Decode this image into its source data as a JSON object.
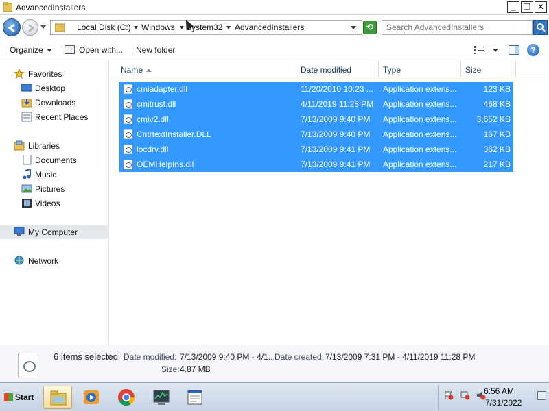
{
  "window": {
    "title": "AdvancedInstallers",
    "controls": {
      "minimize": "_",
      "maximize": "❐",
      "close": "✕"
    }
  },
  "address": {
    "crumbs": [
      "Local Disk (C:)",
      "Windows",
      "System32",
      "AdvancedInstallers"
    ],
    "search_placeholder": "Search AdvancedInstallers"
  },
  "toolbar": {
    "organize": "Organize",
    "open_with": "Open with...",
    "new_folder": "New folder"
  },
  "sidebar": {
    "favorites": {
      "label": "Favorites",
      "icon": "star-icon",
      "items": [
        "Desktop",
        "Downloads",
        "Recent Places"
      ]
    },
    "libraries": {
      "label": "Libraries",
      "icon": "library-icon",
      "items": [
        "Documents",
        "Music",
        "Pictures",
        "Videos"
      ]
    },
    "computer": {
      "label": "My Computer",
      "icon": "computer-icon"
    },
    "network": {
      "label": "Network",
      "icon": "network-icon"
    }
  },
  "columns": {
    "name": "Name",
    "date_modified": "Date modified",
    "type": "Type",
    "size": "Size"
  },
  "files": [
    {
      "name": "cmiadapter.dll",
      "date": "11/20/2010 10:23 ...",
      "type": "Application extens...",
      "size": "123 KB"
    },
    {
      "name": "cmitrust.dll",
      "date": "4/11/2019 11:28 PM",
      "type": "Application extens...",
      "size": "468 KB"
    },
    {
      "name": "cmiv2.dll",
      "date": "7/13/2009 9:40 PM",
      "type": "Application extens...",
      "size": "3,652 KB"
    },
    {
      "name": "CntrtextInstaller.DLL",
      "date": "7/13/2009 9:40 PM",
      "type": "Application extens...",
      "size": "167 KB"
    },
    {
      "name": "locdrv.dll",
      "date": "7/13/2009 9:41 PM",
      "type": "Application extens...",
      "size": "362 KB"
    },
    {
      "name": "OEMHelpIns.dll",
      "date": "7/13/2009 9:41 PM",
      "type": "Application extens...",
      "size": "217 KB"
    }
  ],
  "details": {
    "count": "6 items selected",
    "date_modified_label": "Date modified:",
    "date_modified_value": "7/13/2009 9:40 PM - 4/1...",
    "date_created_label": "Date created:",
    "date_created_value": "7/13/2009 7:31 PM - 4/11/2019 11:28 PM",
    "size_label": "Size:",
    "size_value": "4.87 MB"
  },
  "taskbar": {
    "start": "Start",
    "apps": [
      "explorer-icon",
      "media-player-icon",
      "chrome-icon",
      "task-manager-icon",
      "notepad-icon"
    ],
    "time": "6:56 AM",
    "date": "7/31/2022"
  },
  "colors": {
    "selection": "#3399ff",
    "header_text": "#1e3a5a",
    "taskbar": "#c6d4e6"
  }
}
